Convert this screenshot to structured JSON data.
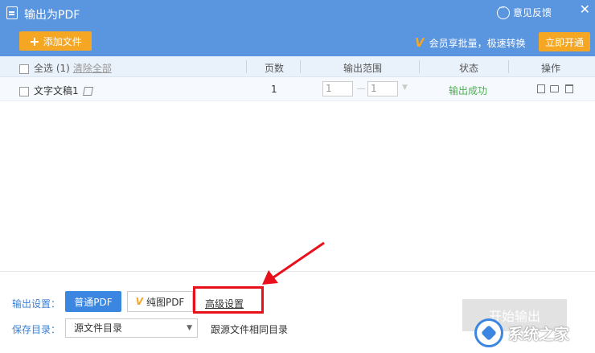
{
  "window": {
    "title": "输出为PDF",
    "feedback_label": "意见反馈",
    "close_glyph": "✕"
  },
  "toolbar": {
    "add_file_label": "添加文件",
    "promo_text": "会员享批量，极速转换",
    "vip_button_label": "立即开通"
  },
  "table": {
    "select_all_label": "全选 (1)",
    "clear_all_label": "清除全部",
    "columns": [
      "页数",
      "输出范围",
      "状态",
      "操作"
    ],
    "rows": [
      {
        "file_name": "文字文稿1",
        "pages": "1",
        "range_from": "1",
        "range_to": "1",
        "status": "输出成功"
      }
    ]
  },
  "output_settings": {
    "label": "输出设置：",
    "normal_pdf_label": "普通PDF",
    "image_pdf_label": "纯图PDF",
    "advanced_label": "高级设置"
  },
  "save_dir": {
    "label": "保存目录：",
    "selected": "源文件目录",
    "hint": "跟源文件相同目录"
  },
  "start_button_label": "开始输出",
  "watermark_text": "系统之家",
  "colors": {
    "header_blue": "#5a95e0",
    "accent_orange": "#f5a623",
    "success_green": "#4caf50",
    "annotation_red": "#e8101a"
  }
}
